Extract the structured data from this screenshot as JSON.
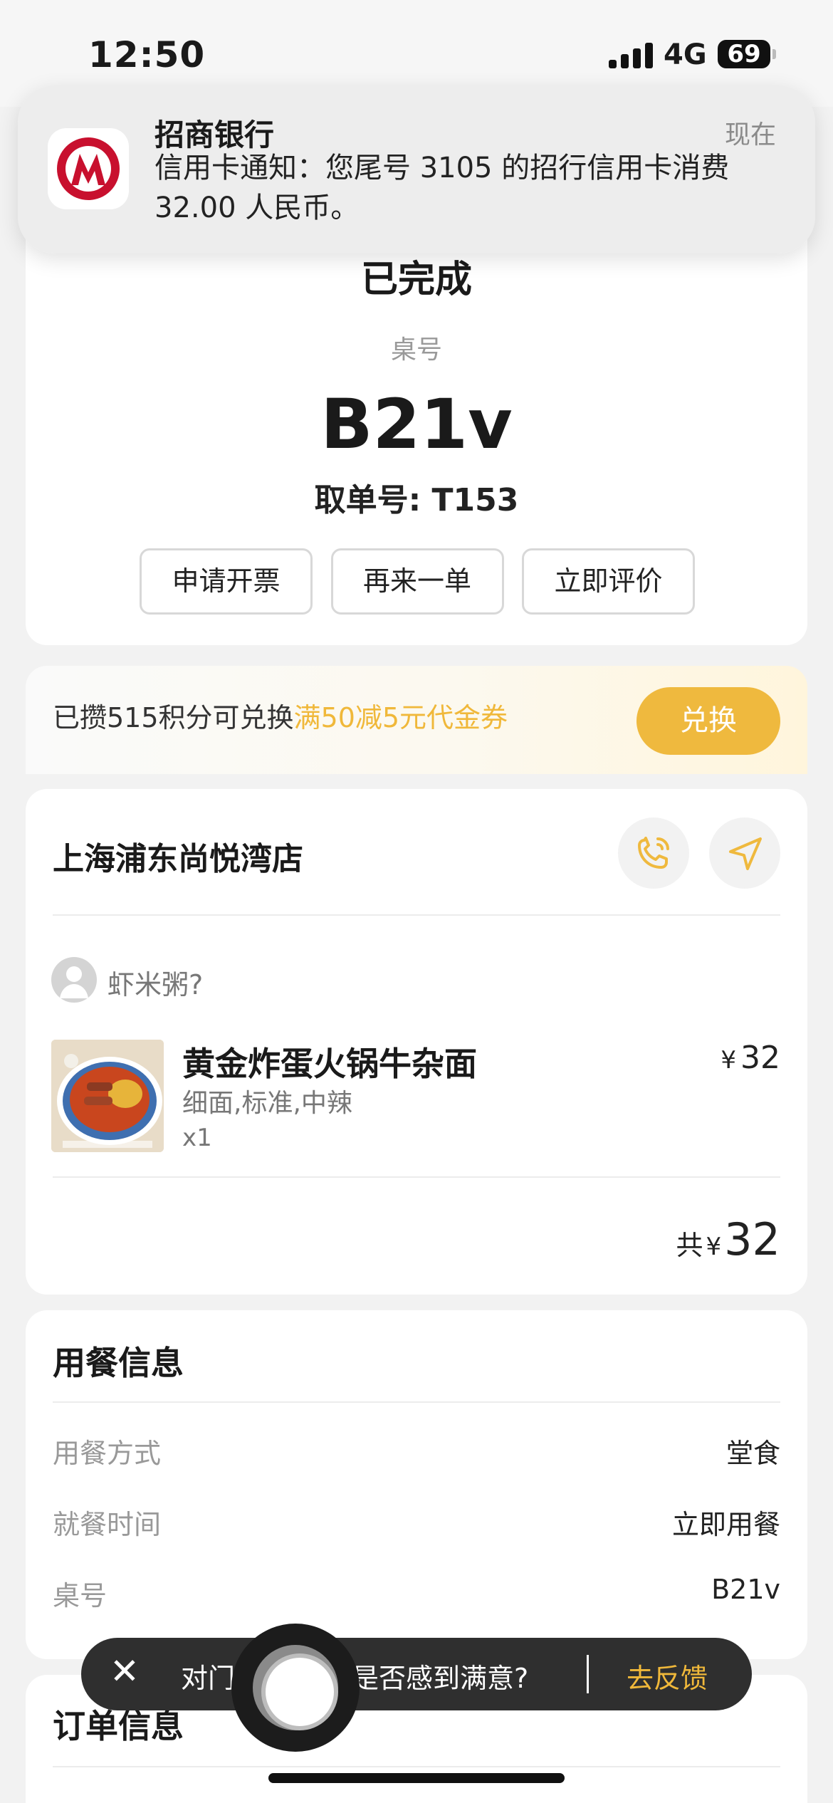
{
  "status_bar": {
    "time": "12:50",
    "network": "4G",
    "battery": "69"
  },
  "notification": {
    "app": "招商银行",
    "time": "现在",
    "body": "信用卡通知：您尾号 3105 的招行信用卡消费 32.00 人民币。"
  },
  "order_status": {
    "status": "已完成",
    "table_label": "桌号",
    "table_value": "B21v",
    "pickup": "取单号: T153",
    "buttons": [
      "申请开票",
      "再来一单",
      "立即评价"
    ]
  },
  "points": {
    "text": "已攒515积分可兑换",
    "highlight": "满50减5元代金券",
    "button": "兑换"
  },
  "order": {
    "store": "上海浦东尚悦湾店",
    "user": "虾米粥?",
    "item": {
      "name": "黄金炸蛋火锅牛杂面",
      "options": "细面,标准,中辣",
      "qty": "x1",
      "currency": "¥",
      "price": "32"
    },
    "total_label": "共",
    "total_currency": "¥",
    "total": "32"
  },
  "dining": {
    "title": "用餐信息",
    "rows": [
      {
        "k": "用餐方式",
        "v": "堂食"
      },
      {
        "k": "就餐时间",
        "v": "立即用餐"
      },
      {
        "k": "桌号",
        "v": "B21v"
      }
    ]
  },
  "order_info": {
    "title": "订单信息"
  },
  "toast": {
    "prefix": "对门",
    "question": "是否感到满意?",
    "feedback": "去反馈"
  },
  "colors": {
    "accent": "#efb93e",
    "bank_red": "#c8102e"
  }
}
